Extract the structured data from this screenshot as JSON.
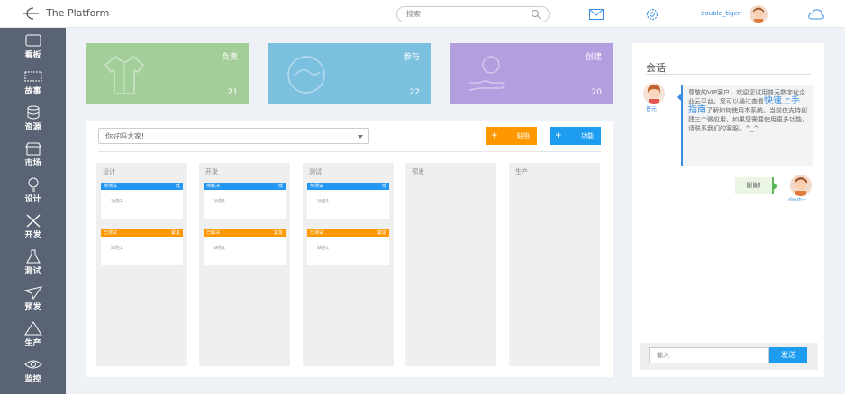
{
  "header": {
    "title": "The Platform",
    "search_placeholder": "搜索",
    "username": "double_tiger"
  },
  "sidebar": {
    "items": [
      {
        "label": "看板",
        "icon": "board-icon"
      },
      {
        "label": "故事",
        "icon": "film-icon"
      },
      {
        "label": "资源",
        "icon": "database-icon"
      },
      {
        "label": "市场",
        "icon": "store-icon"
      },
      {
        "label": "设计",
        "icon": "bulb-icon"
      },
      {
        "label": "开发",
        "icon": "tools-icon"
      },
      {
        "label": "测试",
        "icon": "flask-icon"
      },
      {
        "label": "预发",
        "icon": "paper-plane-icon"
      },
      {
        "label": "生产",
        "icon": "triangle-icon"
      },
      {
        "label": "监控",
        "icon": "eye-icon"
      }
    ]
  },
  "cards": [
    {
      "label": "负责",
      "count": "21",
      "color": "#a3cd99"
    },
    {
      "label": "参与",
      "count": "22",
      "color": "#7cc0e0"
    },
    {
      "label": "创建",
      "count": "20",
      "color": "#b39ee0"
    }
  ],
  "main": {
    "greeting": "你好吗大家!",
    "bug_button": "缺陷",
    "feature_button": "功能",
    "columns": [
      {
        "title": "设计",
        "tasks": [
          {
            "status": "待测试",
            "tag": "低",
            "text": "功能1",
            "color": "#2196f3"
          },
          {
            "status": "已测试",
            "tag": "紧急",
            "text": "缺陷1",
            "color": "#ff9800"
          }
        ]
      },
      {
        "title": "开发",
        "tasks": [
          {
            "status": "待解决",
            "tag": "低",
            "text": "功能1",
            "color": "#2196f3"
          },
          {
            "status": "已解决",
            "tag": "紧急",
            "text": "缺陷1",
            "color": "#ff9800"
          }
        ]
      },
      {
        "title": "测试",
        "tasks": [
          {
            "status": "待测试",
            "tag": "低",
            "text": "功能1",
            "color": "#2196f3"
          },
          {
            "status": "已测试",
            "tag": "紧急",
            "text": "缺陷1",
            "color": "#ff9800"
          }
        ]
      },
      {
        "title": "预发",
        "tasks": []
      },
      {
        "title": "生产",
        "tasks": []
      }
    ]
  },
  "chat": {
    "title": "会话",
    "agent_name": "普元",
    "agent_msg_1": "尊敬的VIP客户，欢迎您试用普元数字化企业云平台。您可以通过查看",
    "agent_msg_link": "快速上手指南",
    "agent_msg_2": "了解如何使用本系统。当前仅支持创建三个微应用，如果您需要使用更多功能，请联系我们的客服。^_^",
    "user_msg": "谢谢!",
    "user_name": "doub···",
    "input_placeholder": "输入",
    "send_label": "发送"
  }
}
